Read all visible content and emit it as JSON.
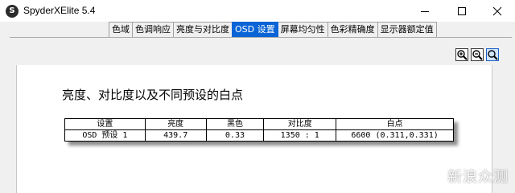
{
  "window": {
    "app_icon_letter": "S",
    "title": "SpyderXElite 5.4"
  },
  "tabs": [
    {
      "label": "色域",
      "active": false
    },
    {
      "label": "色调响应",
      "active": false
    },
    {
      "label": "亮度与对比度",
      "active": false
    },
    {
      "label": "OSD 设置",
      "active": true
    },
    {
      "label": "屏幕均匀性",
      "active": false
    },
    {
      "label": "色彩精确度",
      "active": false
    },
    {
      "label": "显示器额定值",
      "active": false
    }
  ],
  "zoom_controls": [
    {
      "icon": "zoom-in-icon"
    },
    {
      "icon": "zoom-out-icon"
    },
    {
      "icon": "zoom-fit-icon"
    }
  ],
  "report": {
    "heading": "亮度、对比度以及不同预设的白点",
    "table": {
      "headers": [
        "设置",
        "亮度",
        "黑色",
        "对比度",
        "白点"
      ],
      "rows": [
        [
          "OSD 预设 1",
          "439.7",
          "0.33",
          "1350 : 1",
          "6600 (0.311,0.331)"
        ]
      ]
    }
  },
  "watermark": "新浪众测",
  "colors": {
    "active_tab": "#0a64d6",
    "chrome_bg": "#f0f0f0"
  }
}
